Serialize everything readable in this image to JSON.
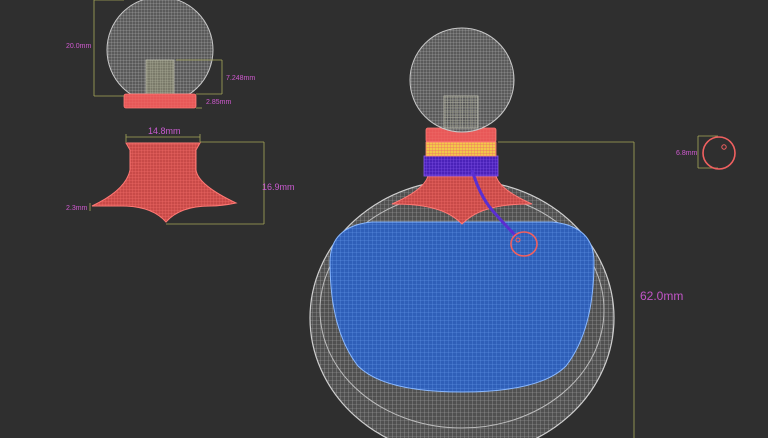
{
  "dimensions": {
    "cap_height": "20.0mm",
    "cap_inner": "7.248mm",
    "cap_band": "2.85mm",
    "neck_width": "14.8mm",
    "neck_height": "16.9mm",
    "stand_edge": "2.3mm",
    "bottle_height": "62.0mm",
    "ring_diameter": "6.8mm"
  },
  "colors": {
    "background": "#2f2f2f",
    "wire_white": "#bfbfbf",
    "wire_red": "#f06060",
    "wire_blue": "#3a7be0",
    "wire_purple": "#5b2fd0",
    "wire_yellow": "#f2c84a",
    "dim_green": "#a8a95a",
    "dim_magenta": "#d05ad0"
  }
}
